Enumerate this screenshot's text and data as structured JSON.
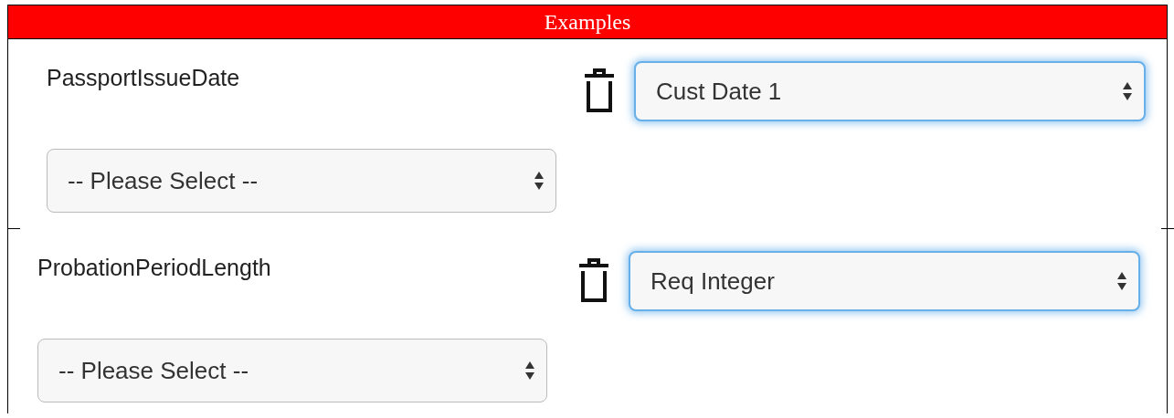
{
  "panel": {
    "title": "Examples"
  },
  "rows": [
    {
      "label": "PassportIssueDate",
      "mapped_select": {
        "value": "Cust Date 1",
        "focused": true
      },
      "type_select": {
        "value": "-- Please Select --",
        "focused": false
      }
    },
    {
      "label": "ProbationPeriodLength",
      "mapped_select": {
        "value": "Req Integer",
        "focused": true
      },
      "type_select": {
        "value": "-- Please Select --",
        "focused": false
      }
    }
  ]
}
